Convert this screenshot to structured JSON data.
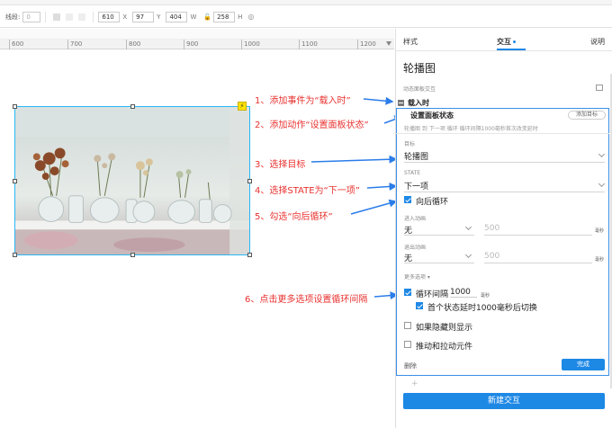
{
  "toolbar": {
    "line_label": "线段:",
    "line_value": "0",
    "x_value": "610",
    "x_label": "X",
    "y_value": "97",
    "y_label": "Y",
    "w_value": "404",
    "w_label": "W",
    "h_value": "258",
    "h_label": "H"
  },
  "ruler": {
    "ticks": [
      "600",
      "700",
      "800",
      "900",
      "1000",
      "1100",
      "1200"
    ]
  },
  "annotations": [
    "1、添加事件为“载入时”",
    "2、添加动作“设置面板状态”",
    "3、选择目标",
    "4、选择STATE为“下一项”",
    "5、勾选“向后循环”",
    "6、点击更多选项设置循环间隔"
  ],
  "panel": {
    "tabs": {
      "style": "样式",
      "interact": "交互",
      "notes": "说明"
    },
    "widget_name": "轮播图",
    "section_title": "动态面板交互",
    "event": "载入时",
    "action": "设置面板状态",
    "add_target": "添加目标",
    "summary": "轮播图 到 下一项 循环 循环间隔1000毫秒首次改变延时",
    "target_label": "目标",
    "target_value": "轮播图",
    "state_label": "STATE",
    "state_value": "下一项",
    "wrap_label": "向后循环",
    "enter_label": "进入动画",
    "enter_value": "无",
    "enter_ms": "500",
    "enter_unit": "毫秒",
    "exit_label": "退出动画",
    "exit_value": "无",
    "exit_ms": "500",
    "exit_unit": "毫秒",
    "more_options": "更多选项 ▾",
    "loop_label": "循环间隔",
    "loop_value": "1000",
    "loop_unit": "毫秒",
    "first_delay_label": "首个状态延时1000毫秒后切换",
    "hide_show_label": "如果隐藏则显示",
    "push_pull_label": "推动和拉动元件",
    "delete": "删除",
    "done": "完成",
    "plus": "+",
    "new_interaction": "新建交互"
  },
  "colors": {
    "accent": "#1e88e5",
    "annotation": "#e8322f",
    "selection": "#29b6f6"
  }
}
